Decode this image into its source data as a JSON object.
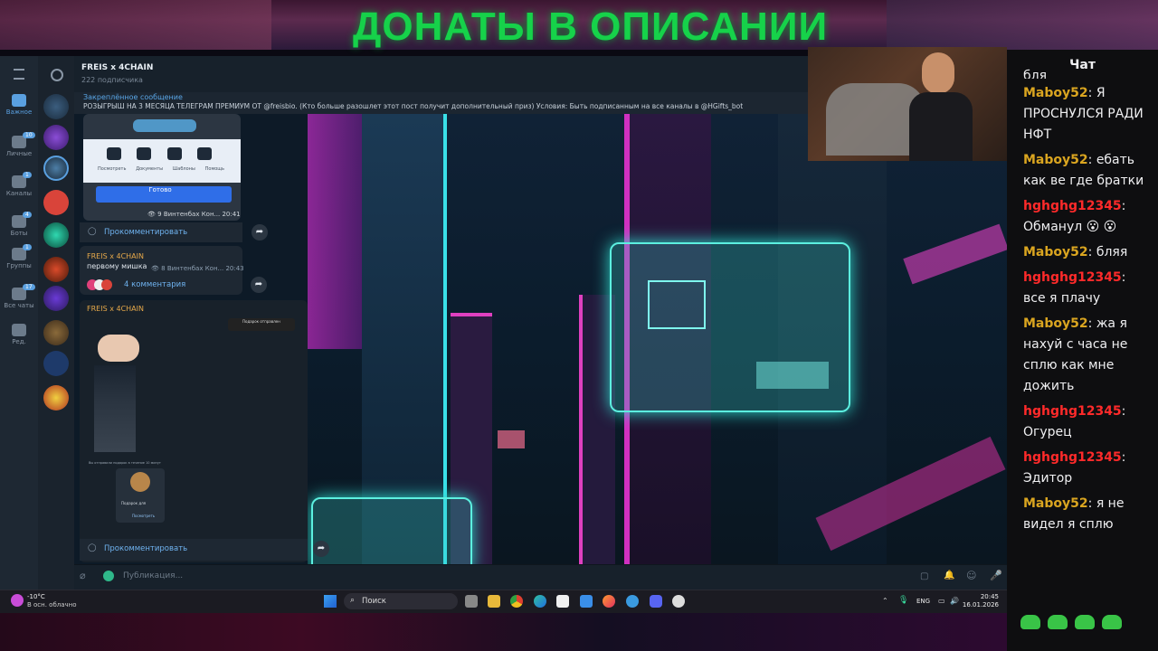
{
  "overlay": {
    "banner_title": "ДОНАТЫ В ОПИСАНИИ"
  },
  "telegram": {
    "sidebar": [
      {
        "label": "Важное",
        "icon": "folder-icon",
        "badge": ""
      },
      {
        "label": "Личные",
        "icon": "user-icon",
        "badge": "10"
      },
      {
        "label": "Каналы",
        "icon": "channel-icon",
        "badge": "1"
      },
      {
        "label": "Боты",
        "icon": "bot-icon",
        "badge": "4"
      },
      {
        "label": "Группы",
        "icon": "group-icon",
        "badge": "1"
      },
      {
        "label": "Все чаты",
        "icon": "chats-icon",
        "badge": "17"
      },
      {
        "label": "Ред.",
        "icon": "edit-icon",
        "badge": ""
      }
    ],
    "channel": {
      "title": "FREIS x 4CHAIN",
      "subscribers": "222 подписчика"
    },
    "pinned": {
      "title": "Закреплённое сообщение",
      "text": "РОЗЫГРЫШ НА 3 МЕСЯЦА ТЕЛЕГРАМ ПРЕМИУМ ОТ @freisbio. (Кто больше разошлет этот пост получит дополнительный приз)  Условия: Быть подписанным на все каналы в @HGifts_bot"
    },
    "messages": [
      {
        "ready_button": "Готово",
        "actions": [
          "Посмотреть",
          "Документы",
          "Шаблоны",
          "Помощь"
        ],
        "views": "9",
        "author": "Винтенбах Кон...",
        "time": "20:41",
        "comment": "Прокомментировать"
      },
      {
        "sender": "FREIS x 4CHAIN",
        "text": "первому мишка",
        "views": "8",
        "author": "Винтенбах Кон...",
        "time": "20:43",
        "comment": "4 комментария"
      },
      {
        "sender": "FREIS x 4CHAIN",
        "notice": "Подарок отправлен",
        "gift_caption": "Вы отправили подарок в течение 10 минут",
        "gift_label": "Подарок для",
        "gift_action": "Посмотреть",
        "comment": "Прокомментировать"
      }
    ],
    "composer": {
      "placeholder": "Публикация..."
    }
  },
  "taskbar": {
    "weather_temp": "-10°C",
    "weather_desc": "В осн. облачно",
    "search": "Поиск",
    "lang": "ENG",
    "time": "20:45",
    "date": "16.01.2026"
  },
  "twitch_chat": {
    "title": "Чат",
    "messages": [
      {
        "user": "",
        "text": "бля"
      },
      {
        "user": "Maboy52",
        "text": "Я ПРОСНУЛСЯ РАДИ НФТ"
      },
      {
        "user": "Maboy52",
        "text": "ебать как ве где братки"
      },
      {
        "user": "hghghg12345",
        "text": "Обманул 😮 😮"
      },
      {
        "user": "Maboy52",
        "text": "бляя"
      },
      {
        "user": "hghghg12345",
        "text": "все я плачу"
      },
      {
        "user": "Maboy52",
        "text": "жа я нахуй с часа не сплю как мне дожить"
      },
      {
        "user": "hghghg12345",
        "text": "Огурец"
      },
      {
        "user": "hghghg12345",
        "text": "Эдитор"
      },
      {
        "user": "Maboy52",
        "text": "я не видел я сплю"
      }
    ]
  },
  "colors": {
    "banner_green": "#16d24a",
    "maboy": "#daa520",
    "hghghg": "#ff2a2a",
    "link": "#6fb3f0"
  }
}
